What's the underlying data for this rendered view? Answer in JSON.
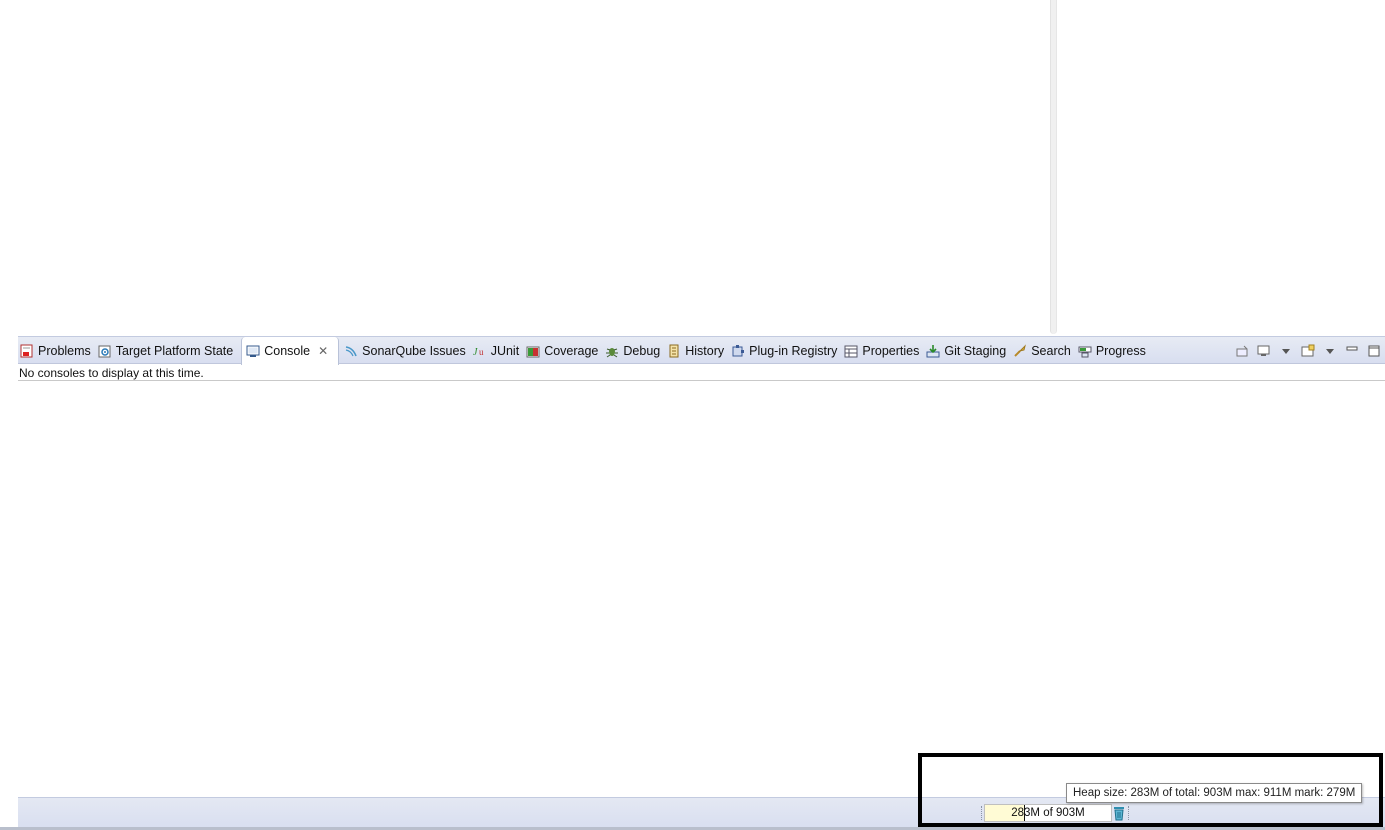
{
  "view_tabs": [
    {
      "label": "Problems",
      "icon": "problems-icon"
    },
    {
      "label": "Target Platform State",
      "icon": "target-platform-icon"
    },
    {
      "label": "Console",
      "icon": "console-icon",
      "active": true
    },
    {
      "label": "SonarQube Issues",
      "icon": "sonarqube-icon"
    },
    {
      "label": "JUnit",
      "icon": "junit-icon"
    },
    {
      "label": "Coverage",
      "icon": "coverage-icon"
    },
    {
      "label": "Debug",
      "icon": "debug-icon"
    },
    {
      "label": "History",
      "icon": "history-icon"
    },
    {
      "label": "Plug-in Registry",
      "icon": "plugin-registry-icon"
    },
    {
      "label": "Properties",
      "icon": "properties-icon"
    },
    {
      "label": "Git Staging",
      "icon": "git-staging-icon"
    },
    {
      "label": "Search",
      "icon": "search-icon"
    },
    {
      "label": "Progress",
      "icon": "progress-icon"
    }
  ],
  "console": {
    "close_glyph": "✕",
    "message": "No consoles to display at this time."
  },
  "view_toolbar": [
    "pin-console-icon",
    "display-selected-console-icon",
    "open-console-icon",
    "view-menu-icon",
    "minimize-icon",
    "maximize-icon"
  ],
  "heap": {
    "label": "283M of 903M",
    "used_mb": 283,
    "total_mb": 903,
    "max_mb": 911,
    "mark_mb": 279,
    "tooltip": "Heap size: 283M of total: 903M max: 911M mark: 279M"
  },
  "colors": {
    "tabbar": "#dde2f0",
    "heap_fill": "#fffbd5",
    "gc_icon": "#2f8fb0",
    "highlight_border": "#000000"
  }
}
